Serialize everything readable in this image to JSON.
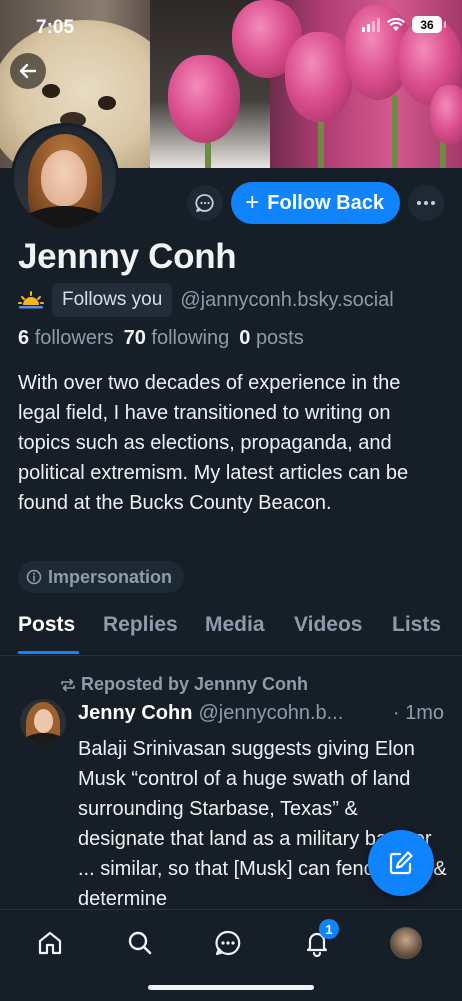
{
  "status_bar": {
    "time": "7:05",
    "battery": "36"
  },
  "profile": {
    "display_name": "Jennny Conh",
    "follows_you_label": "Follows you",
    "handle": "@jannyconh.bsky.social",
    "followers_count": "6",
    "followers_label": "followers",
    "following_count": "70",
    "following_label": "following",
    "posts_count": "0",
    "posts_label": "posts",
    "bio": "With over two decades of experience in the legal field, I have transitioned to writing on topics such as elections, propaganda, and political extremism. My latest articles can be found at the Bucks County Beacon.",
    "label_badge": "Impersonation",
    "emoji": "sunrise"
  },
  "actions": {
    "follow_label": "Follow Back",
    "follow_icon": "+"
  },
  "tabs": [
    "Posts",
    "Replies",
    "Media",
    "Videos",
    "Lists"
  ],
  "feed": {
    "repost_label": "Reposted by Jennny Conh",
    "post": {
      "author": "Jenny Cohn",
      "handle": "@jennycohn.b...",
      "time": "· 1mo",
      "text": "Balaji Srinivasan suggests giving Elon Musk “control of a huge swath of land surrounding Starbase, Texas” & designate that land as a military base or ... similar, so that [Musk] can fence it off & determine"
    }
  },
  "bottom_nav": {
    "items": [
      "home-icon",
      "search-icon",
      "chat-icon",
      "bell-icon",
      "profile-avatar"
    ],
    "notification_count": "1"
  },
  "colors": {
    "accent": "#1083fe",
    "background": "#161e27",
    "muted": "#8e9bab"
  }
}
